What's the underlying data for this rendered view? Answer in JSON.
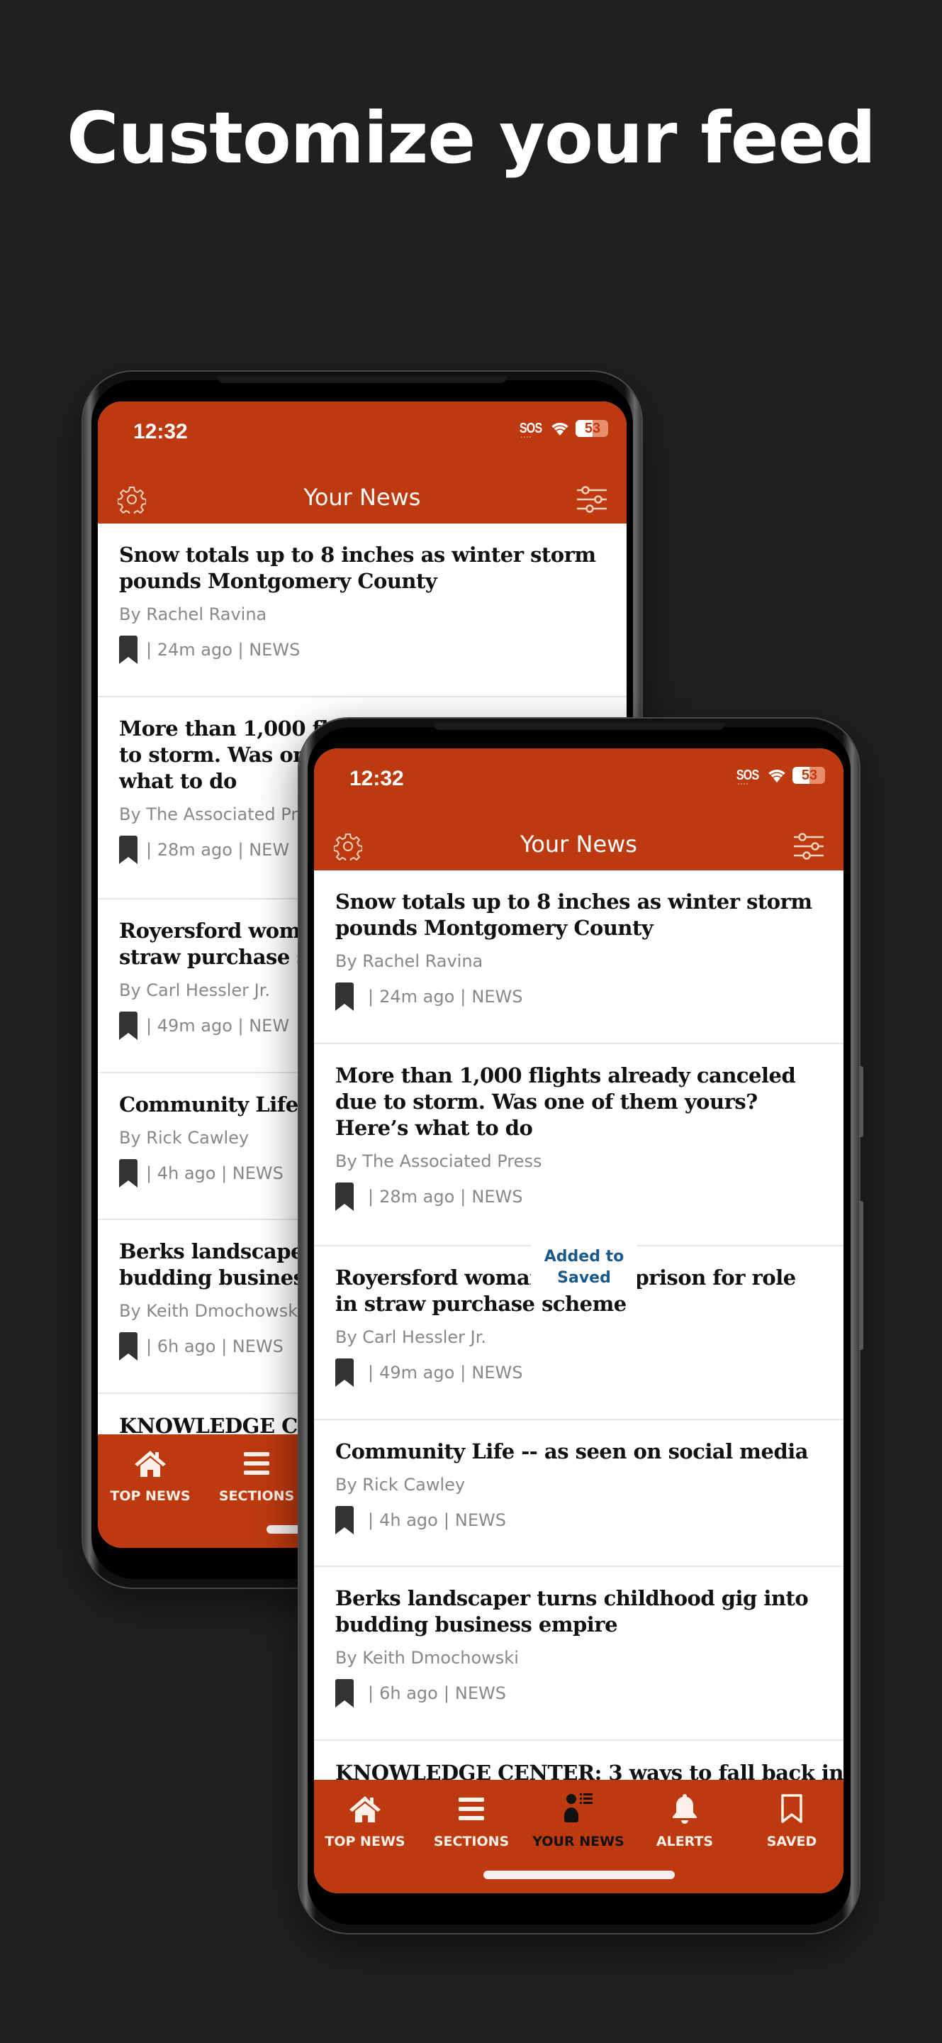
{
  "headline": "Customize your feed",
  "status_bar": {
    "time": "12:32",
    "carrier": "SOS",
    "battery_level": "53",
    "battery_percent": 53
  },
  "nav": {
    "title": "Your News",
    "settings_icon": "gear-icon",
    "filter_icon": "sliders-icon"
  },
  "articles": [
    {
      "title": "Snow totals up to 8 inches as winter storm pounds Montgomery County",
      "byline": "By Rachel Ravina",
      "time": "24m ago",
      "section": "NEWS",
      "saved": true
    },
    {
      "title": "More than 1,000 flights already canceled due to storm. Was one of them yours? Here’s what to do",
      "byline": "By The Associated Press",
      "time": "28m ago",
      "section": "NEWS",
      "saved": true
    },
    {
      "title": "Royersford woman sent to prison for role in straw purchase scheme",
      "title_visible_front": [
        "Royersford woma",
        "rison for role in",
        "straw purchase scheme"
      ],
      "byline": "By Carl Hessler Jr.",
      "time": "49m ago",
      "section": "NEWS",
      "saved": true
    },
    {
      "title": "Community Life -- as seen on social media",
      "byline": "By Rick Cawley",
      "time": "4h ago",
      "section": "NEWS",
      "saved": true
    },
    {
      "title": "Berks landscaper turns childhood gig into budding business empire",
      "byline": "By Keith Dmochowski",
      "time": "6h ago",
      "section": "NEWS",
      "saved": true
    },
    {
      "title": "KNOWLEDGE CENTER: 3 ways to fall back in"
    }
  ],
  "back_phone": {
    "visible_titles": [
      [
        "Snow totals up to 8 inches as winter storm",
        "pounds Montgomery County"
      ],
      [
        "More than 1,000 fl",
        "to storm. Was on",
        "what to do"
      ],
      [
        "Royersford woma",
        "straw purchase s"
      ],
      [
        "Community Life"
      ],
      [
        "Berks landscaper",
        "budding business"
      ],
      [
        "KNOWLEDGE CE"
      ]
    ],
    "visible_bylines": [
      "By Rachel Ravina",
      "By The Associated Pr",
      "By Carl Hessler Jr.",
      "By Rick Cawley",
      "By Keith Dmochowski"
    ],
    "visible_meta": [
      "| 24m ago | NEWS",
      "| 28m ago | NEW",
      "| 49m ago | NEW",
      "| 4h ago | NEWS",
      "| 6h ago | NEWS"
    ]
  },
  "toast": {
    "line1": "Added to",
    "line2": "Saved"
  },
  "meta_separator": "|",
  "tabs": [
    {
      "label": "TOP NEWS",
      "icon": "home-icon",
      "active": false
    },
    {
      "label": "SECTIONS",
      "icon": "menu-icon",
      "active": false
    },
    {
      "label": "YOUR NEWS",
      "icon": "person-list-icon",
      "active": true
    },
    {
      "label": "ALERTS",
      "icon": "bell-icon",
      "active": false
    },
    {
      "label": "SAVED",
      "icon": "bookmark-icon",
      "active": false
    }
  ],
  "colors": {
    "brand": "#bd3a10",
    "toast_text": "#1a5a8a",
    "background": "#211f20"
  }
}
